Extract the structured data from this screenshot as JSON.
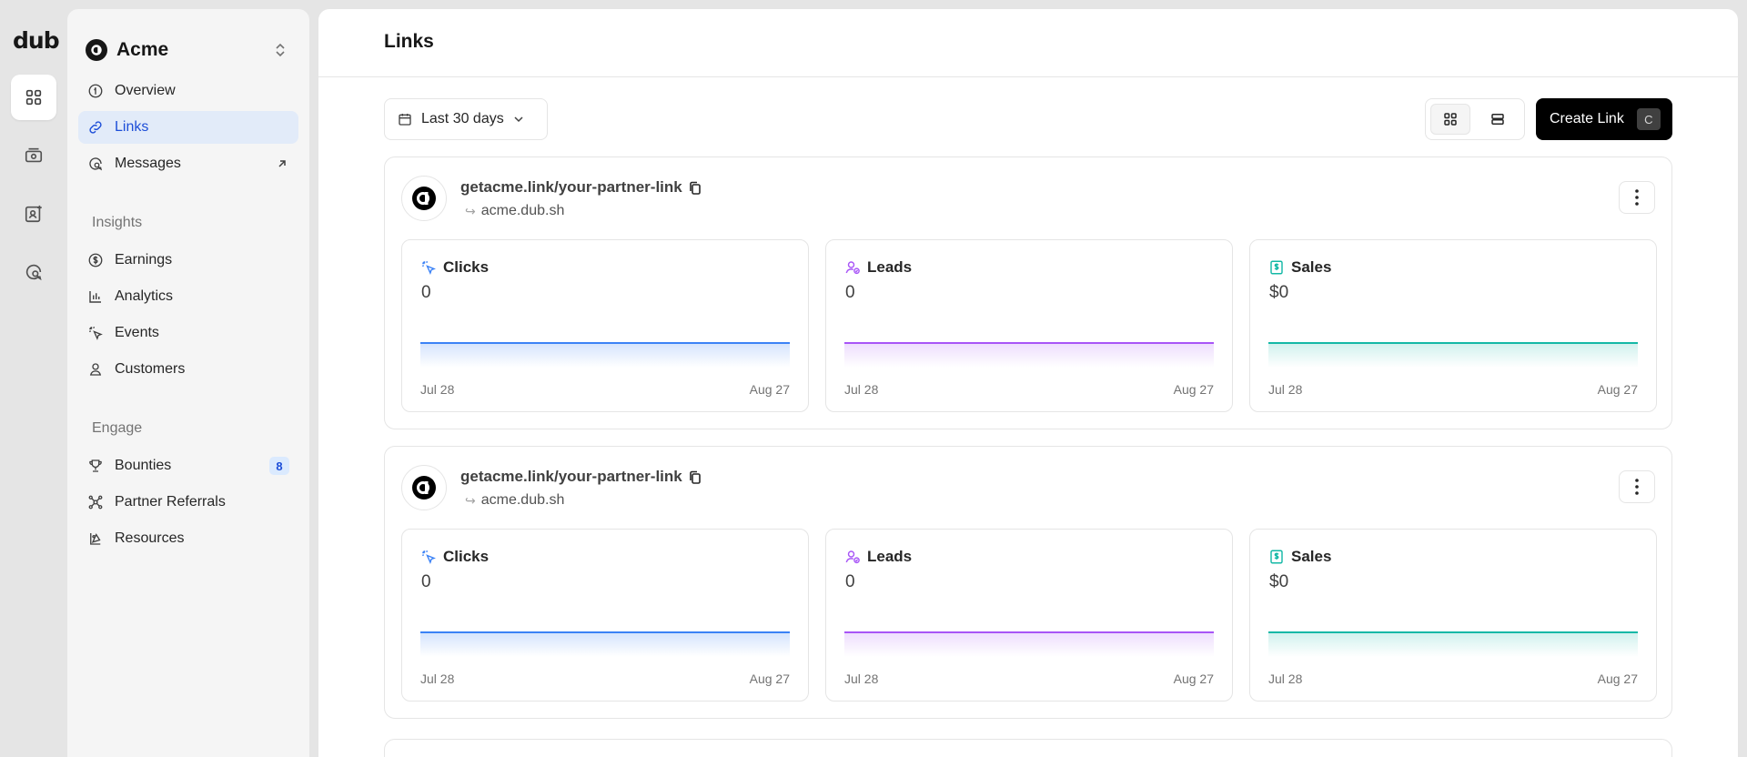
{
  "rail": {
    "logo": "dub"
  },
  "workspace": {
    "name": "Acme"
  },
  "nav": {
    "overview": "Overview",
    "links": "Links",
    "messages": "Messages",
    "insights_title": "Insights",
    "earnings": "Earnings",
    "analytics": "Analytics",
    "events": "Events",
    "customers": "Customers",
    "engage_title": "Engage",
    "bounties": "Bounties",
    "bounties_count": "8",
    "partner_referrals": "Partner Referrals",
    "resources": "Resources"
  },
  "page": {
    "title": "Links",
    "date_range": "Last 30 days",
    "create_label": "Create Link",
    "create_shortcut": "C"
  },
  "colors": {
    "clicks": "#3b82f6",
    "leads": "#a855f7",
    "sales": "#14b8a6",
    "active_nav": "#1d4ed8"
  },
  "links": [
    {
      "url": "getacme.link/your-partner-link",
      "destination": "acme.dub.sh",
      "stats": [
        {
          "label": "Clicks",
          "value": "0",
          "icon": "cursor-click-icon",
          "start": "Jul 28",
          "end": "Aug 27"
        },
        {
          "label": "Leads",
          "value": "0",
          "icon": "user-check-icon",
          "start": "Jul 28",
          "end": "Aug 27"
        },
        {
          "label": "Sales",
          "value": "$0",
          "icon": "invoice-dollar-icon",
          "start": "Jul 28",
          "end": "Aug 27"
        }
      ]
    },
    {
      "url": "getacme.link/your-partner-link",
      "destination": "acme.dub.sh",
      "stats": [
        {
          "label": "Clicks",
          "value": "0",
          "icon": "cursor-click-icon",
          "start": "Jul 28",
          "end": "Aug 27"
        },
        {
          "label": "Leads",
          "value": "0",
          "icon": "user-check-icon",
          "start": "Jul 28",
          "end": "Aug 27"
        },
        {
          "label": "Sales",
          "value": "$0",
          "icon": "invoice-dollar-icon",
          "start": "Jul 28",
          "end": "Aug 27"
        }
      ]
    }
  ]
}
